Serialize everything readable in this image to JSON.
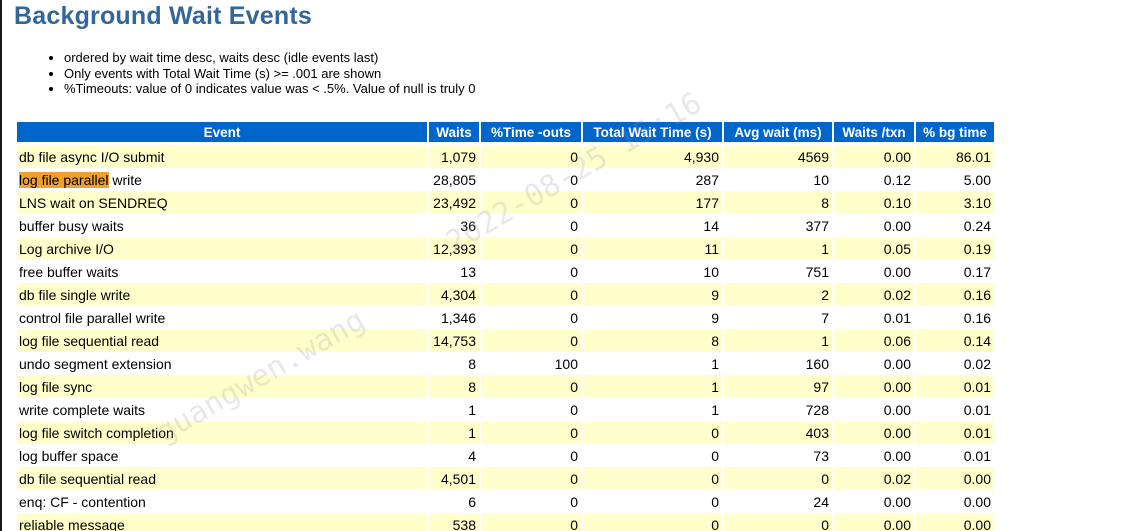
{
  "title": "Background Wait Events",
  "notes": [
    "ordered by wait time desc, waits desc (idle events last)",
    "Only events with Total Wait Time (s) >= .001 are shown",
    "%Timeouts: value of 0 indicates value was < .5%. Value of null is truly 0"
  ],
  "table": {
    "headers": [
      "Event",
      "Waits",
      "%Time -outs",
      "Total Wait Time (s)",
      "Avg wait (ms)",
      "Waits /txn",
      "% bg time"
    ],
    "rows": [
      [
        "db file async I/O submit",
        "1,079",
        "0",
        "4,930",
        "4569",
        "0.00",
        "86.01"
      ],
      [
        "log file parallel write",
        "28,805",
        "0",
        "287",
        "10",
        "0.12",
        "5.00"
      ],
      [
        "LNS wait on SENDREQ",
        "23,492",
        "0",
        "177",
        "8",
        "0.10",
        "3.10"
      ],
      [
        "buffer busy waits",
        "36",
        "0",
        "14",
        "377",
        "0.00",
        "0.24"
      ],
      [
        "Log archive I/O",
        "12,393",
        "0",
        "11",
        "1",
        "0.05",
        "0.19"
      ],
      [
        "free buffer waits",
        "13",
        "0",
        "10",
        "751",
        "0.00",
        "0.17"
      ],
      [
        "db file single write",
        "4,304",
        "0",
        "9",
        "2",
        "0.02",
        "0.16"
      ],
      [
        "control file parallel write",
        "1,346",
        "0",
        "9",
        "7",
        "0.01",
        "0.16"
      ],
      [
        "log file sequential read",
        "14,753",
        "0",
        "8",
        "1",
        "0.06",
        "0.14"
      ],
      [
        "undo segment extension",
        "8",
        "100",
        "1",
        "160",
        "0.00",
        "0.02"
      ],
      [
        "log file sync",
        "8",
        "0",
        "1",
        "97",
        "0.00",
        "0.01"
      ],
      [
        "write complete waits",
        "1",
        "0",
        "1",
        "728",
        "0.00",
        "0.01"
      ],
      [
        "log file switch completion",
        "1",
        "0",
        "0",
        "403",
        "0.00",
        "0.01"
      ],
      [
        "log buffer space",
        "4",
        "0",
        "0",
        "73",
        "0.00",
        "0.01"
      ],
      [
        "db file sequential read",
        "4,501",
        "0",
        "0",
        "0",
        "0.02",
        "0.00"
      ],
      [
        "enq: CF - contention",
        "6",
        "0",
        "0",
        "24",
        "0.00",
        "0.00"
      ],
      [
        "reliable message",
        "538",
        "0",
        "0",
        "0",
        "0.00",
        "0.00"
      ]
    ],
    "highlight": {
      "row": 1,
      "text": "log file parallel",
      "rest": " write",
      "color": "#f0a030"
    }
  },
  "colors": {
    "title": "#336699",
    "header_bg": "#0066cc",
    "odd_row_bg": "#ffffcc",
    "even_row_bg": "#ffffff"
  },
  "watermark": {
    "lines": [
      "guangwen.wang",
      "2022-08-25 15:16"
    ]
  }
}
